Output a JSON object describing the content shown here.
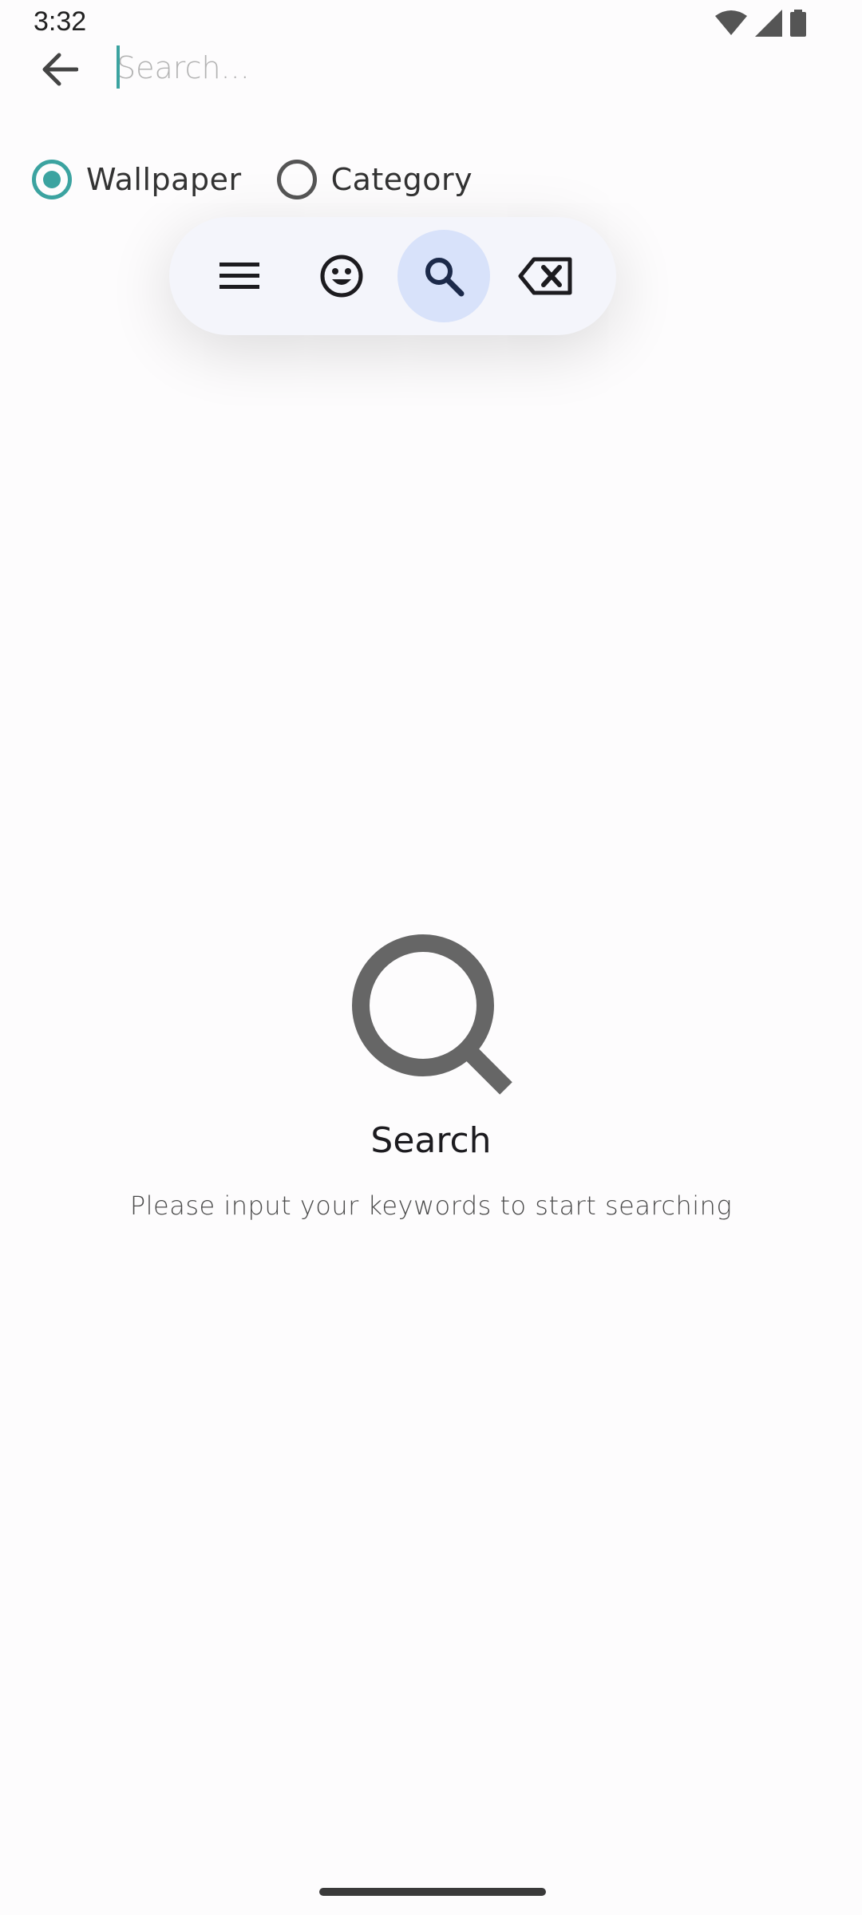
{
  "status_bar": {
    "time": "3:32"
  },
  "search": {
    "placeholder": "Search...",
    "value": ""
  },
  "filter": {
    "options": [
      {
        "label": "Wallpaper",
        "checked": true
      },
      {
        "label": "Category",
        "checked": false
      }
    ],
    "accent_color": "#3ba3a0"
  },
  "toolbar": {
    "items": [
      {
        "icon": "menu-icon"
      },
      {
        "icon": "emoji-icon"
      },
      {
        "icon": "search-icon",
        "active": true
      },
      {
        "icon": "backspace-icon"
      }
    ]
  },
  "empty_state": {
    "icon": "search-icon",
    "title": "Search",
    "subtitle": "Please input your keywords to start searching"
  }
}
